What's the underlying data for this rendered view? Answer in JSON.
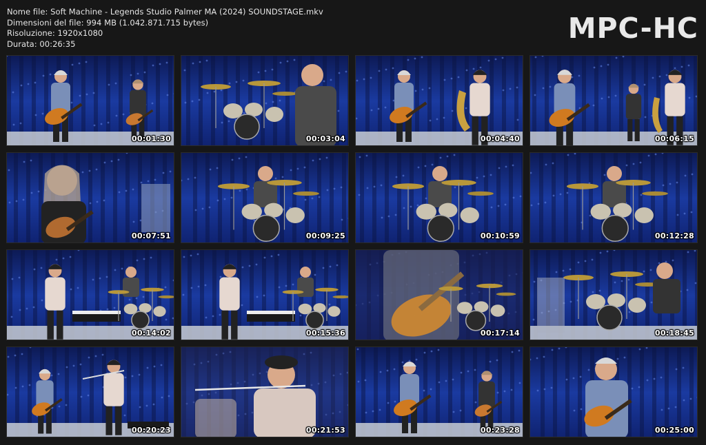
{
  "info": {
    "file_name": "Nome file: Soft Machine - Legends Studio Palmer MA (2024) SOUNDSTAGE.mkv",
    "file_size": "Dimensioni del file: 994 MB (1.042.871.715 bytes)",
    "resolution": "Risoluzione: 1920x1080",
    "duration": "Durata: 00:26:35"
  },
  "logo": "MPC-HC",
  "thumbnails": [
    {
      "time": "00:01:30",
      "scene": "guitar-bass"
    },
    {
      "time": "00:03:04",
      "scene": "drummer-closeup"
    },
    {
      "time": "00:04:40",
      "scene": "guitar-sax"
    },
    {
      "time": "00:06:15",
      "scene": "guitar-bass-sax"
    },
    {
      "time": "00:07:51",
      "scene": "bassist-closeup"
    },
    {
      "time": "00:09:25",
      "scene": "drum-kit"
    },
    {
      "time": "00:10:59",
      "scene": "drum-kit"
    },
    {
      "time": "00:12:28",
      "scene": "drum-kit"
    },
    {
      "time": "00:14:02",
      "scene": "keys-drums"
    },
    {
      "time": "00:15:36",
      "scene": "keys-drums"
    },
    {
      "time": "00:17:14",
      "scene": "guitar-overlay"
    },
    {
      "time": "00:18:45",
      "scene": "drummer-side"
    },
    {
      "time": "00:20:23",
      "scene": "flute-band"
    },
    {
      "time": "00:21:53",
      "scene": "flute-overlay"
    },
    {
      "time": "00:23:28",
      "scene": "guitar-bass"
    },
    {
      "time": "00:25:00",
      "scene": "guitarist-solo"
    }
  ],
  "colors": {
    "backdrop": "#1a3aa0",
    "backdrop_dark": "#0a1540",
    "floor": "#c8ccd4"
  }
}
